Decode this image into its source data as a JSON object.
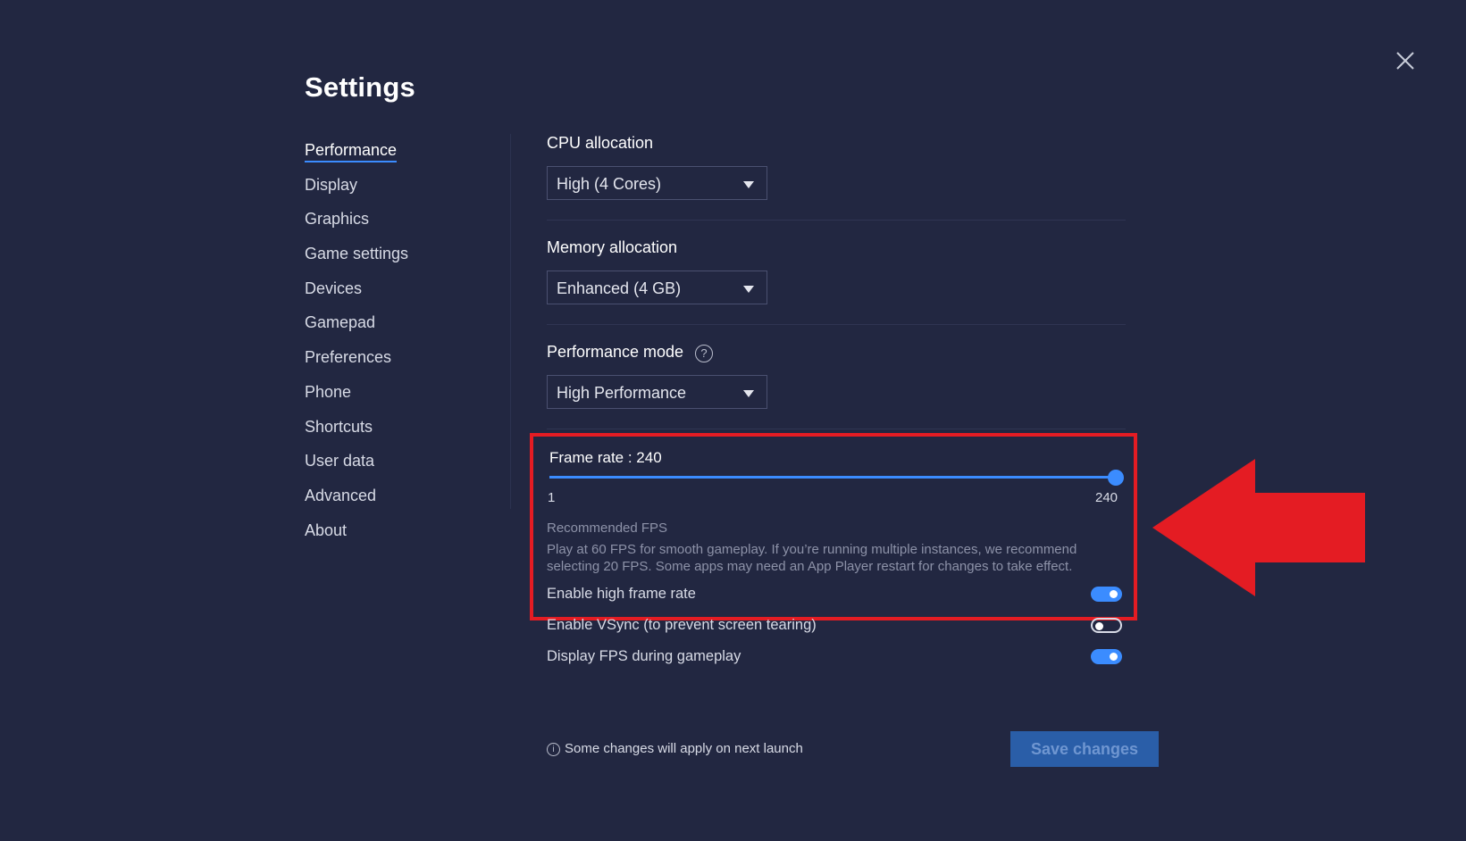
{
  "title": "Settings",
  "nav": {
    "items": [
      {
        "label": "Performance",
        "active": true
      },
      {
        "label": "Display"
      },
      {
        "label": "Graphics"
      },
      {
        "label": "Game settings"
      },
      {
        "label": "Devices"
      },
      {
        "label": "Gamepad"
      },
      {
        "label": "Preferences"
      },
      {
        "label": "Phone"
      },
      {
        "label": "Shortcuts"
      },
      {
        "label": "User data"
      },
      {
        "label": "Advanced"
      },
      {
        "label": "About"
      }
    ]
  },
  "cpu": {
    "label": "CPU allocation",
    "value": "High (4 Cores)"
  },
  "memory": {
    "label": "Memory allocation",
    "value": "Enhanced (4 GB)"
  },
  "perf_mode": {
    "label": "Performance mode",
    "value": "High Performance",
    "help_icon": "question-circle-icon"
  },
  "frame_rate": {
    "label": "Frame rate : 240",
    "min": "1",
    "max": "240",
    "value": 240,
    "recommended_title": "Recommended FPS",
    "recommended_text": "Play at 60 FPS for smooth gameplay. If you’re running multiple instances, we recommend selecting 20 FPS. Some apps may need an App Player restart for changes to take effect."
  },
  "toggles": {
    "high_frame_rate": {
      "label": "Enable high frame rate",
      "on": true
    },
    "vsync": {
      "label": "Enable VSync (to prevent screen tearing)",
      "on": false
    },
    "display_fps": {
      "label": "Display FPS during gameplay",
      "on": true
    }
  },
  "footer": {
    "note": "Some changes will apply on next launch",
    "save_label": "Save changes"
  },
  "colors": {
    "background": "#222741",
    "accent": "#3b8cff",
    "highlight_red": "#e41c23"
  }
}
